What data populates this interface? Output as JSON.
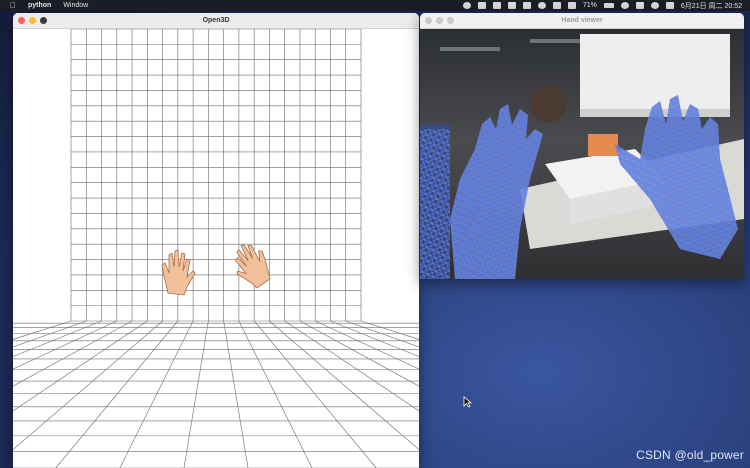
{
  "menubar": {
    "app_name": "python",
    "menu_window": "Window",
    "battery": "71%",
    "datetime": "6月21日 周二  20:52",
    "apple_icon": "apple-logo",
    "status_icons": [
      "record-icon",
      "arrow-icon",
      "app-icon",
      "app-icon",
      "app-icon",
      "wechat-icon",
      "app-icon",
      "app-icon",
      "app-icon",
      "translate-icon",
      "wifi-icon",
      "control-icon",
      "user-icon",
      "menu-icon"
    ]
  },
  "open3d_window": {
    "title": "Open3D",
    "grid_color": "#6a6a6a",
    "hand_color": "#f2c19c"
  },
  "hand_viewer_window": {
    "title": "Hand viewer",
    "mesh_color": "#4f74e8"
  },
  "traffic_lights": {
    "close": "#fe5f57",
    "minimize": "#febc2e",
    "zoom": "#28c840",
    "inactive": "#c9c9c9"
  },
  "watermark": "CSDN @old_power"
}
